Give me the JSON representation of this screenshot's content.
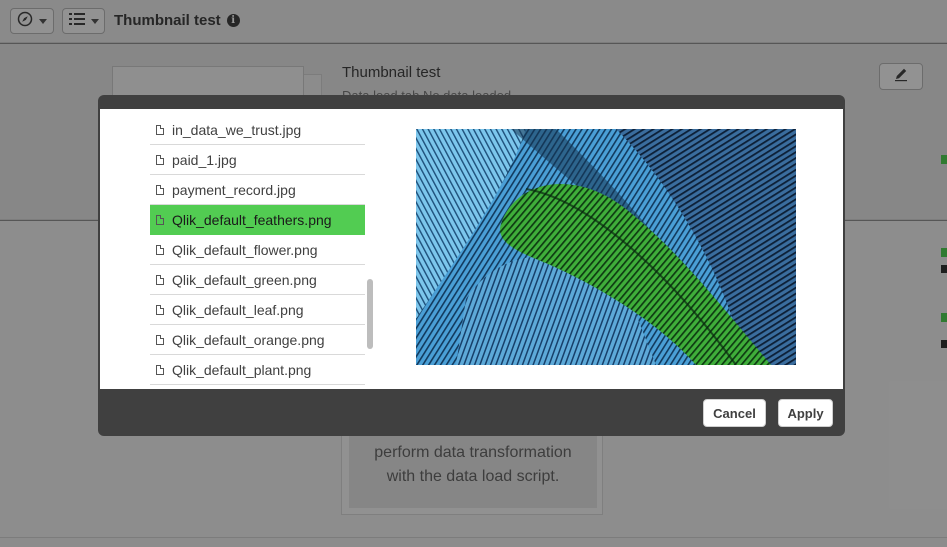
{
  "app": {
    "title": "Thumbnail test",
    "info_icon": "info-icon",
    "compass_icon": "compass-icon",
    "list_icon": "list-icon"
  },
  "sheet": {
    "title": "Thumbnail test",
    "description": "Data load tab No data loaded",
    "edit_icon": "pencil-icon"
  },
  "background_card": {
    "text_line1": "perform data transformation",
    "text_line2": "with the data load script."
  },
  "dialog": {
    "files": [
      {
        "name": "in_data_we_trust.jpg",
        "selected": false
      },
      {
        "name": "paid_1.jpg",
        "selected": false
      },
      {
        "name": "payment_record.jpg",
        "selected": false
      },
      {
        "name": "Qlik_default_feathers.png",
        "selected": true
      },
      {
        "name": "Qlik_default_flower.png",
        "selected": false
      },
      {
        "name": "Qlik_default_green.png",
        "selected": false
      },
      {
        "name": "Qlik_default_leaf.png",
        "selected": false
      },
      {
        "name": "Qlik_default_orange.png",
        "selected": false
      },
      {
        "name": "Qlik_default_plant.png",
        "selected": false
      }
    ],
    "cancel_label": "Cancel",
    "apply_label": "Apply"
  },
  "colors": {
    "selection_green": "#52cc52",
    "dialog_dark": "#404040"
  }
}
